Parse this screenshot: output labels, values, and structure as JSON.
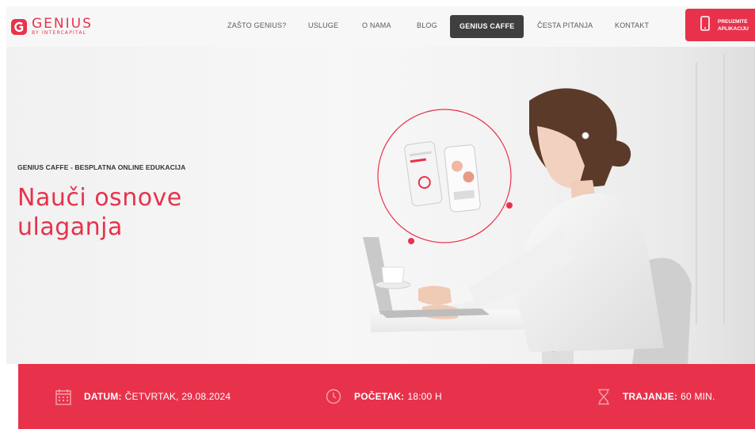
{
  "header": {
    "logo": {
      "title": "GENIUS",
      "subtitle": "BY INTERCAPITAL"
    },
    "nav": [
      {
        "label": "ZAŠTO GENIUS?"
      },
      {
        "label": "USLUGE"
      },
      {
        "label": "O NAMA"
      },
      {
        "label": "BLOG"
      },
      {
        "label": "GENIUS CAFFE"
      },
      {
        "label": "ČESTA PITANJA"
      },
      {
        "label": "KONTAKT"
      }
    ],
    "active_nav": "GENIUS CAFFE",
    "download": {
      "line1": "PREUZMITE",
      "line2": "APLIKACIJU",
      "icon": "smartphone-icon"
    }
  },
  "hero": {
    "kicker": "GENIUS CAFFE - BESPLATNA ONLINE EDUKACIJA",
    "title_line1": "Nauči osnove",
    "title_line2": "ulaganja"
  },
  "info": {
    "date": {
      "label": "DATUM:",
      "value": "ČETVRTAK, 29.08.2024",
      "icon": "calendar-icon"
    },
    "start": {
      "label": "POČETAK:",
      "value": "18:00 H",
      "icon": "clock-icon"
    },
    "duration": {
      "label": "TRAJANJE:",
      "value": "60 MIN.",
      "icon": "hourglass-icon"
    }
  },
  "colors": {
    "accent": "#e8324b",
    "nav_active": "#3f3f3f",
    "text": "#5a5a5a"
  }
}
